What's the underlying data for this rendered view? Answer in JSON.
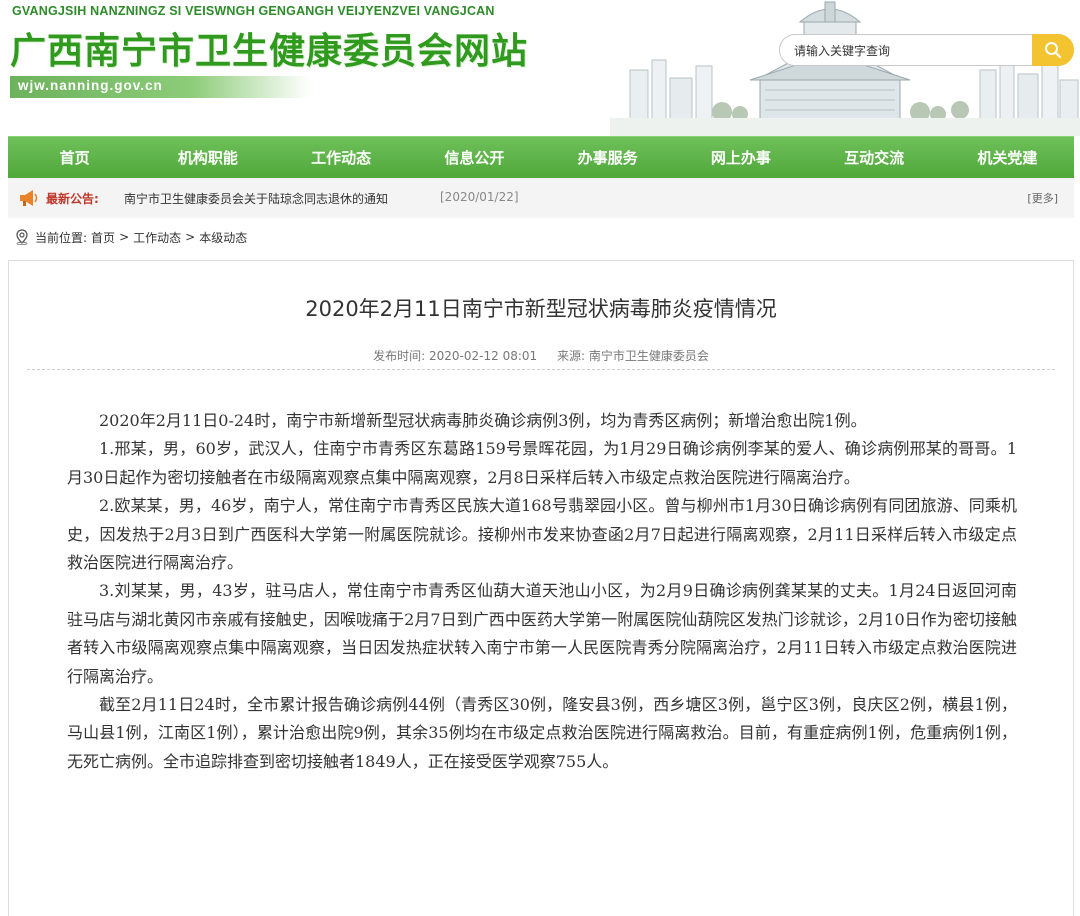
{
  "header": {
    "pinyin": "GVANGJSIH NANZNINGZ SI VEISWNGH GENGANGH VEIJYENZVEI VANGJCAN",
    "title": "广西南宁市卫生健康委员会网站",
    "domain": "wjw.nanning.gov.cn",
    "search_placeholder": "请输入关键字查询",
    "search_icon": "search-icon"
  },
  "nav": {
    "items": [
      {
        "label": "首页"
      },
      {
        "label": "机构职能"
      },
      {
        "label": "工作动态"
      },
      {
        "label": "信息公开"
      },
      {
        "label": "办事服务"
      },
      {
        "label": "网上办事"
      },
      {
        "label": "互动交流"
      },
      {
        "label": "机关党建"
      }
    ]
  },
  "notice": {
    "label": "最新公告:",
    "text": "南宁市卫生健康委员会关于陆琼念同志退休的通知",
    "date": "[2020/01/22]",
    "more": "[更多]"
  },
  "breadcrumb": {
    "prefix": "当前位置:",
    "items": [
      "首页",
      "工作动态",
      "本级动态"
    ],
    "separator": ">"
  },
  "article": {
    "title": "2020年2月11日南宁市新型冠状病毒肺炎疫情情况",
    "publish_time": "发布时间: 2020-02-12 08:01",
    "source": "来源: 南宁市卫生健康委员会",
    "paragraphs": [
      "2020年2月11日0-24时，南宁市新增新型冠状病毒肺炎确诊病例3例，均为青秀区病例；新增治愈出院1例。",
      "1.邢某，男，60岁，武汉人，住南宁市青秀区东葛路159号景晖花园，为1月29日确诊病例李某的爱人、确诊病例邢某的哥哥。1月30日起作为密切接触者在市级隔离观察点集中隔离观察，2月8日采样后转入市级定点救治医院进行隔离治疗。",
      "2.欧某某，男，46岁，南宁人，常住南宁市青秀区民族大道168号翡翠园小区。曾与柳州市1月30日确诊病例有同团旅游、同乘机史，因发热于2月3日到广西医科大学第一附属医院就诊。接柳州市发来协查函2月7日起进行隔离观察，2月11日采样后转入市级定点救治医院进行隔离治疗。",
      "3.刘某某，男，43岁，驻马店人，常住南宁市青秀区仙葫大道天池山小区，为2月9日确诊病例龚某某的丈夫。1月24日返回河南驻马店与湖北黄冈市亲戚有接触史，因喉咙痛于2月7日到广西中医药大学第一附属医院仙葫院区发热门诊就诊，2月10日作为密切接触者转入市级隔离观察点集中隔离观察，当日因发热症状转入南宁市第一人民医院青秀分院隔离治疗，2月11日转入市级定点救治医院进行隔离治疗。",
      "截至2月11日24时，全市累计报告确诊病例44例（青秀区30例，隆安县3例，西乡塘区3例，邕宁区3例，良庆区2例，横县1例，马山县1例，江南区1例），累计治愈出院9例，其余35例均在市级定点救治医院进行隔离救治。目前，有重症病例1例，危重病例1例，无死亡病例。全市追踪排查到密切接触者1849人，正在接受医学观察755人。"
    ]
  },
  "colors": {
    "brand_green": "#2f9a1d",
    "nav_green": "#5ab245",
    "search_yellow": "#f4c430",
    "notice_red": "#c0392b"
  }
}
